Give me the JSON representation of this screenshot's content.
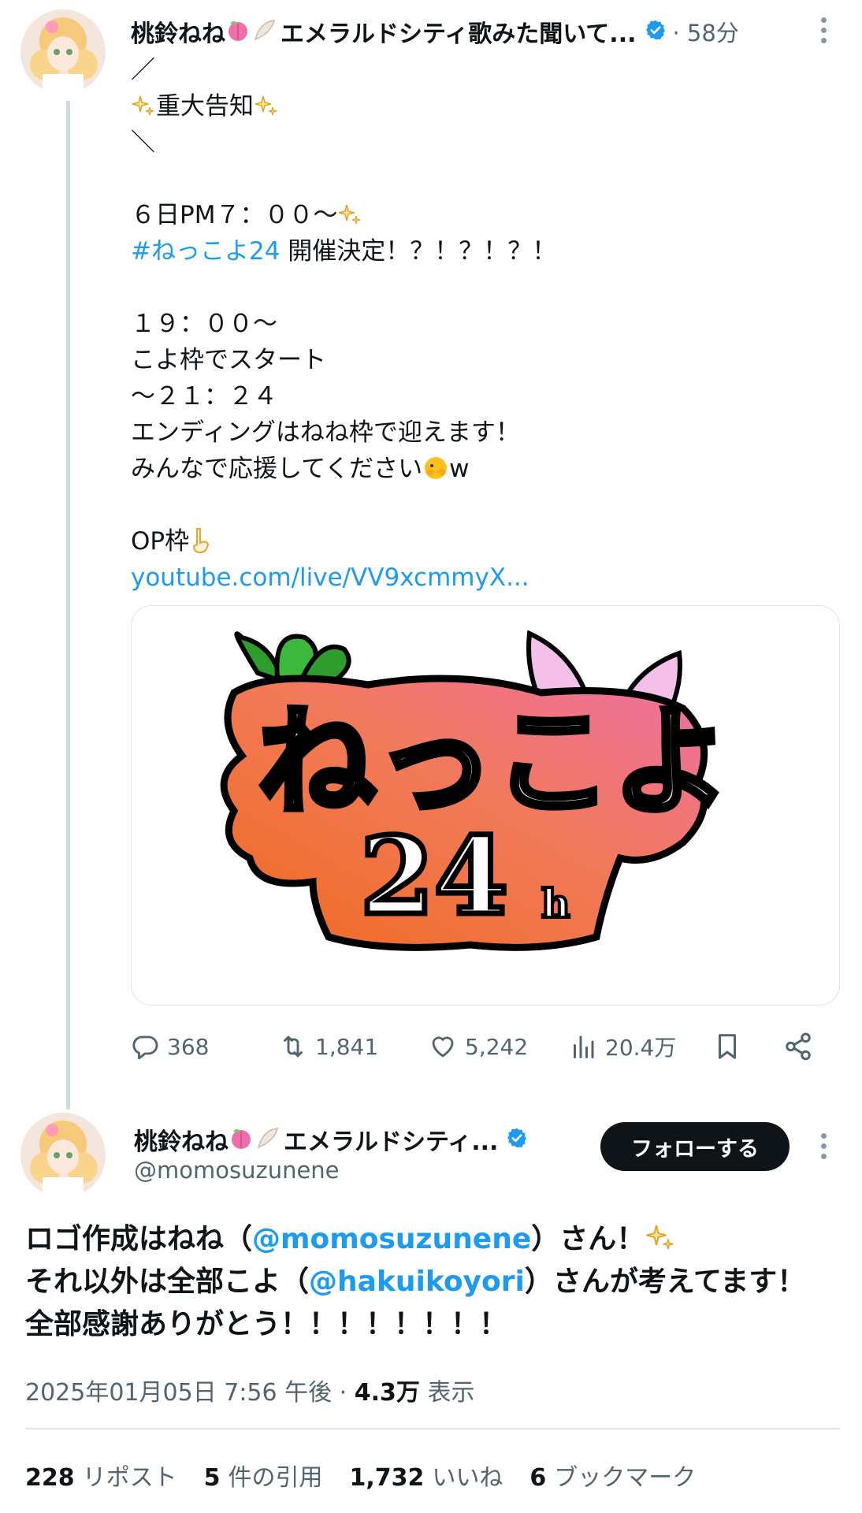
{
  "tweet1": {
    "display_name": "桃鈴ねね",
    "name_suffix": "エメラルドシティ歌みた聞いて...",
    "time": "· 58分",
    "lines": [
      "／",
      "重大告知",
      "＼",
      "",
      "６日PM７：００～",
      "開催決定！？！？！？！",
      "",
      "１９：００～",
      "こよ枠でスタート",
      "～２１：２４",
      "エンディングはねね枠で迎えます！",
      "みんなで応援してください",
      "",
      "OP枠",
      "youtube.com/live/VV9xcmmyX..."
    ],
    "hashtag": "#ねっこよ24",
    "after_emoji_w": "w",
    "card_logo": {
      "main": "ねっこよ",
      "sub": "24",
      "h": "h"
    },
    "actions": {
      "replies": "368",
      "reposts": "1,841",
      "likes": "5,242",
      "views": "20.4万"
    }
  },
  "tweet2": {
    "display_name": "桃鈴ねね",
    "name_suffix": "エメラルドシティ...",
    "handle": "@momosuzunene",
    "follow_label": "フォローする",
    "body": {
      "l1_a": "ロゴ作成はねね（",
      "l1_mention": "@momosuzunene",
      "l1_b": "）さん！",
      "l2_a": "それ以外は全部こよ（",
      "l2_mention": "@hakuikoyori",
      "l2_b": "）さんが考えてます！",
      "l3": "全部感謝ありがとう！！！！！！！！"
    },
    "meta_date": "2025年01月05日 7:56 午後 · ",
    "meta_views": "4.3万",
    "meta_views_label": " 表示",
    "stats": {
      "reposts": "228",
      "reposts_label": "リポスト",
      "quotes": "5",
      "quotes_label": "件の引用",
      "likes": "1,732",
      "likes_label": "いいね",
      "bookmarks": "6",
      "bookmarks_label": "ブックマーク"
    }
  },
  "colors": {
    "accent": "#1d9bf0",
    "text": "#0f1419",
    "muted": "#536471",
    "follow_bg": "#0f1419"
  }
}
